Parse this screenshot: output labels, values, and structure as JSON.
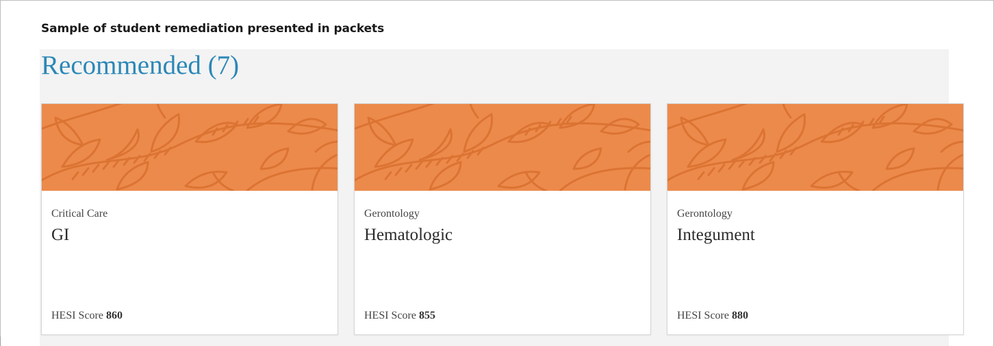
{
  "caption": "Sample of student remediation presented in packets",
  "section": {
    "title": "Recommended (7)"
  },
  "banner_colors": {
    "base": "#ec8a4b",
    "leaf": "#d9702f"
  },
  "cards": [
    {
      "category": "Critical Care",
      "title": "GI",
      "score_label": "HESI Score",
      "score_value": "860"
    },
    {
      "category": "Gerontology",
      "title": "Hematologic",
      "score_label": "HESI Score",
      "score_value": "855"
    },
    {
      "category": "Gerontology",
      "title": "Integument",
      "score_label": "HESI Score",
      "score_value": "880"
    }
  ]
}
